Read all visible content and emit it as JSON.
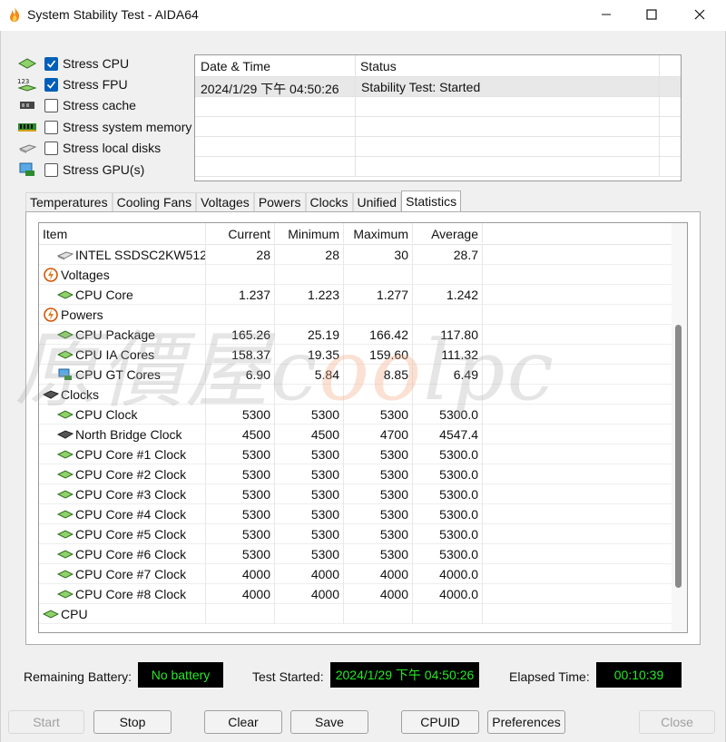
{
  "window": {
    "title": "System Stability Test - AIDA64"
  },
  "stress_options": [
    {
      "label": "Stress CPU",
      "checked": true,
      "icon": "cpu-chip-icon"
    },
    {
      "label": "Stress FPU",
      "checked": true,
      "icon": "fpu-123-icon"
    },
    {
      "label": "Stress cache",
      "checked": false,
      "icon": "cache-icon"
    },
    {
      "label": "Stress system memory",
      "checked": false,
      "icon": "memory-icon"
    },
    {
      "label": "Stress local disks",
      "checked": false,
      "icon": "disk-icon"
    },
    {
      "label": "Stress GPU(s)",
      "checked": false,
      "icon": "gpu-icon"
    }
  ],
  "log": {
    "headers": [
      "Date & Time",
      "Status"
    ],
    "rows": [
      [
        "2024/1/29 下午 04:50:26",
        "Stability Test: Started"
      ]
    ]
  },
  "tabs": [
    "Temperatures",
    "Cooling Fans",
    "Voltages",
    "Powers",
    "Clocks",
    "Unified",
    "Statistics"
  ],
  "active_tab": "Statistics",
  "stats": {
    "headers": [
      "Item",
      "Current",
      "Minimum",
      "Maximum",
      "Average"
    ],
    "rows": [
      {
        "item": "INTEL SSDSC2KW512...",
        "current": "28",
        "min": "28",
        "max": "30",
        "avg": "28.7",
        "indent": 1,
        "icon": "disk-icon"
      },
      {
        "item": "Voltages",
        "current": "",
        "min": "",
        "max": "",
        "avg": "",
        "indent": 0,
        "icon": "voltage-bolt-icon"
      },
      {
        "item": "CPU Core",
        "current": "1.237",
        "min": "1.223",
        "max": "1.277",
        "avg": "1.242",
        "indent": 1,
        "icon": "cpu-chip-icon"
      },
      {
        "item": "Powers",
        "current": "",
        "min": "",
        "max": "",
        "avg": "",
        "indent": 0,
        "icon": "power-bolt-icon"
      },
      {
        "item": "CPU Package",
        "current": "165.26",
        "min": "25.19",
        "max": "166.42",
        "avg": "117.80",
        "indent": 1,
        "icon": "cpu-chip-icon"
      },
      {
        "item": "CPU IA Cores",
        "current": "158.37",
        "min": "19.35",
        "max": "159.60",
        "avg": "111.32",
        "indent": 1,
        "icon": "cpu-chip-icon"
      },
      {
        "item": "CPU GT Cores",
        "current": "6.90",
        "min": "5.84",
        "max": "8.85",
        "avg": "6.49",
        "indent": 1,
        "icon": "gpu-icon"
      },
      {
        "item": "Clocks",
        "current": "",
        "min": "",
        "max": "",
        "avg": "",
        "indent": 0,
        "icon": "motherboard-icon"
      },
      {
        "item": "CPU Clock",
        "current": "5300",
        "min": "5300",
        "max": "5300",
        "avg": "5300.0",
        "indent": 1,
        "icon": "cpu-chip-icon"
      },
      {
        "item": "North Bridge Clock",
        "current": "4500",
        "min": "4500",
        "max": "4700",
        "avg": "4547.4",
        "indent": 1,
        "icon": "motherboard-icon"
      },
      {
        "item": "CPU Core #1 Clock",
        "current": "5300",
        "min": "5300",
        "max": "5300",
        "avg": "5300.0",
        "indent": 1,
        "icon": "cpu-chip-icon"
      },
      {
        "item": "CPU Core #2 Clock",
        "current": "5300",
        "min": "5300",
        "max": "5300",
        "avg": "5300.0",
        "indent": 1,
        "icon": "cpu-chip-icon"
      },
      {
        "item": "CPU Core #3 Clock",
        "current": "5300",
        "min": "5300",
        "max": "5300",
        "avg": "5300.0",
        "indent": 1,
        "icon": "cpu-chip-icon"
      },
      {
        "item": "CPU Core #4 Clock",
        "current": "5300",
        "min": "5300",
        "max": "5300",
        "avg": "5300.0",
        "indent": 1,
        "icon": "cpu-chip-icon"
      },
      {
        "item": "CPU Core #5 Clock",
        "current": "5300",
        "min": "5300",
        "max": "5300",
        "avg": "5300.0",
        "indent": 1,
        "icon": "cpu-chip-icon"
      },
      {
        "item": "CPU Core #6 Clock",
        "current": "5300",
        "min": "5300",
        "max": "5300",
        "avg": "5300.0",
        "indent": 1,
        "icon": "cpu-chip-icon"
      },
      {
        "item": "CPU Core #7 Clock",
        "current": "4000",
        "min": "4000",
        "max": "4000",
        "avg": "4000.0",
        "indent": 1,
        "icon": "cpu-chip-icon"
      },
      {
        "item": "CPU Core #8 Clock",
        "current": "4000",
        "min": "4000",
        "max": "4000",
        "avg": "4000.0",
        "indent": 1,
        "icon": "cpu-chip-icon"
      },
      {
        "item": "CPU",
        "current": "",
        "min": "",
        "max": "",
        "avg": "",
        "indent": 0,
        "icon": "cpu-chip-icon"
      }
    ]
  },
  "watermark": {
    "prefix": "原價屋",
    "brand_c": "c",
    "brand_oo": "oo",
    "brand_rest": "lpc"
  },
  "status_bar": {
    "battery_label": "Remaining Battery:",
    "battery_value": "No battery",
    "test_started_label": "Test Started:",
    "test_started_value": "2024/1/29 下午 04:50:26",
    "elapsed_label": "Elapsed Time:",
    "elapsed_value": "00:10:39"
  },
  "buttons": {
    "start": "Start",
    "stop": "Stop",
    "clear": "Clear",
    "save": "Save",
    "cpuid": "CPUID",
    "preferences": "Preferences",
    "close": "Close"
  },
  "colors": {
    "accent": "#005fb8",
    "status_text": "#27e827",
    "status_bg": "#000000"
  }
}
